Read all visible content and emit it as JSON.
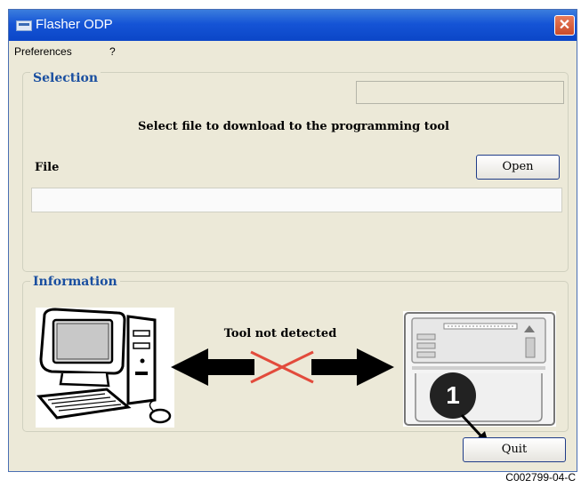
{
  "window": {
    "title": "Flasher ODP",
    "close_glyph": "✕"
  },
  "menu": {
    "items": [
      "Preferences",
      "?"
    ]
  },
  "selection": {
    "group_title": "Selection",
    "prompt": "Select file to download to the programming tool",
    "file_label": "File",
    "open_label": "Open",
    "file_value": ""
  },
  "information": {
    "group_title": "Information",
    "tool_status": "Tool not detected",
    "icons": [
      "computer-icon",
      "disconnected-cross-icon",
      "programming-tool-icon"
    ]
  },
  "footer": {
    "quit_label": "Quit"
  },
  "callout": {
    "number": "1"
  },
  "figure_code": "C002799-04-C",
  "colors": {
    "title_bar": "#1554d6",
    "group_title": "#1a4fa0",
    "window_bg": "#ece9d8",
    "cross": "#e24b3c"
  }
}
